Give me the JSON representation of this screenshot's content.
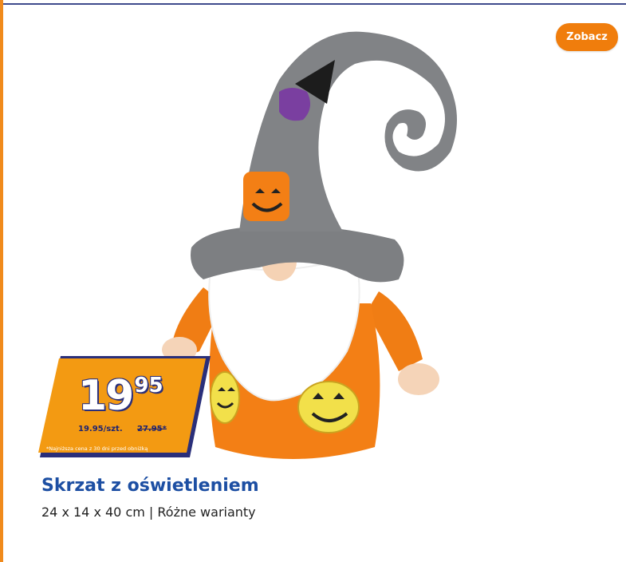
{
  "header": {
    "cta_label": "Zobacz"
  },
  "product": {
    "image_icon": "gnome-figurine-image",
    "title": "Skrzat z oświetleniem",
    "subtitle": "24 x 14 x 40 cm | Różne warianty"
  },
  "price": {
    "integer": "19",
    "decimal": "95",
    "per_unit": "19.95/szt.",
    "old_price": "27.95*",
    "note": "*Najniższa cena z 30 dni przed obniżką"
  },
  "colors": {
    "accent_orange": "#f07d0c",
    "badge_orange": "#f39a12",
    "badge_blue": "#2a2f7a",
    "title_blue": "#1d4fa3",
    "frame_blue": "#3f4a8c"
  }
}
